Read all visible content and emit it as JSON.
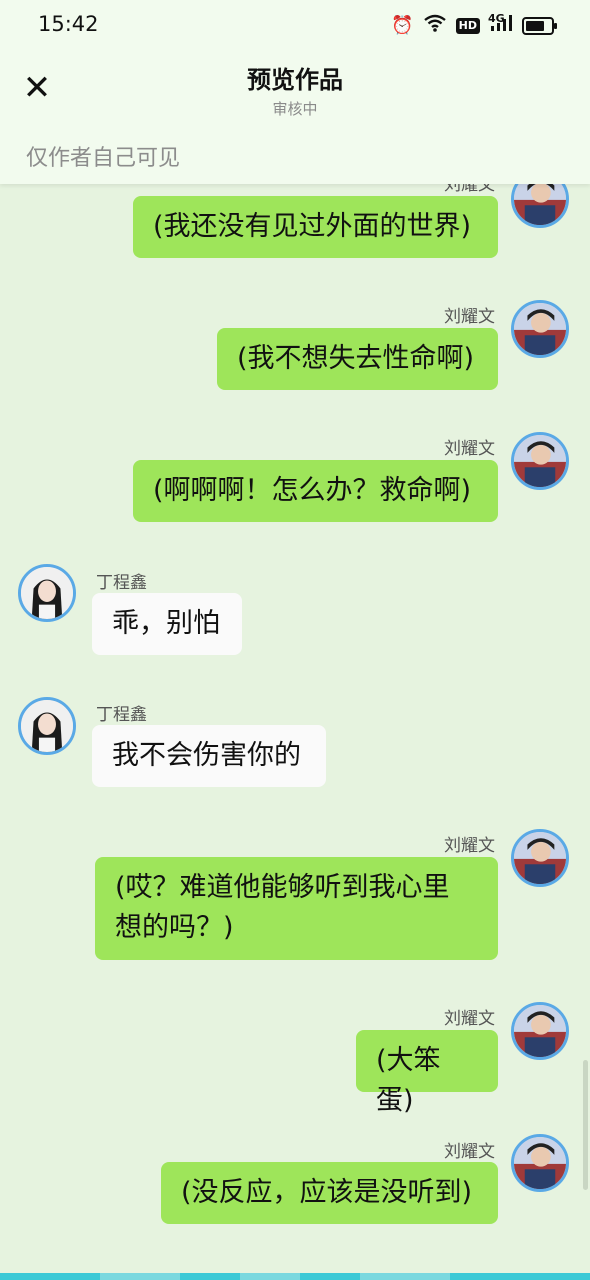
{
  "status": {
    "time": "15:42",
    "icons": [
      "alarm-icon",
      "wifi-icon",
      "hd-icon",
      "signal-4g-icon",
      "battery-icon"
    ],
    "hd_label": "HD",
    "net_label": "4G"
  },
  "header": {
    "close_label": "✕",
    "title": "预览作品",
    "subtitle": "审核中"
  },
  "visibility_note": "仅作者自己可见",
  "colors": {
    "right_bubble": "#9ee55a",
    "left_bubble": "#fafafa",
    "background": "#e6f3df",
    "avatar_ring": "#5aa9e6"
  },
  "messages": [
    {
      "side": "right",
      "name": "刘耀文",
      "text": "(我还没有见过外面的世界)"
    },
    {
      "side": "right",
      "name": "刘耀文",
      "text": "(我不想失去性命啊)"
    },
    {
      "side": "right",
      "name": "刘耀文",
      "text": "(啊啊啊！怎么办？救命啊)"
    },
    {
      "side": "left",
      "name": "丁程鑫",
      "text": "乖，别怕"
    },
    {
      "side": "left",
      "name": "丁程鑫",
      "text": "我不会伤害你的"
    },
    {
      "side": "right",
      "name": "刘耀文",
      "text": "(哎？难道他能够听到我心里想的吗？)",
      "lines": [
        "(哎？难道他能够听到我心里",
        "想的吗？)"
      ]
    },
    {
      "side": "right",
      "name": "刘耀文",
      "text": "(大笨蛋)"
    },
    {
      "side": "right",
      "name": "刘耀文",
      "text": "(没反应，应该是没听到)"
    }
  ]
}
